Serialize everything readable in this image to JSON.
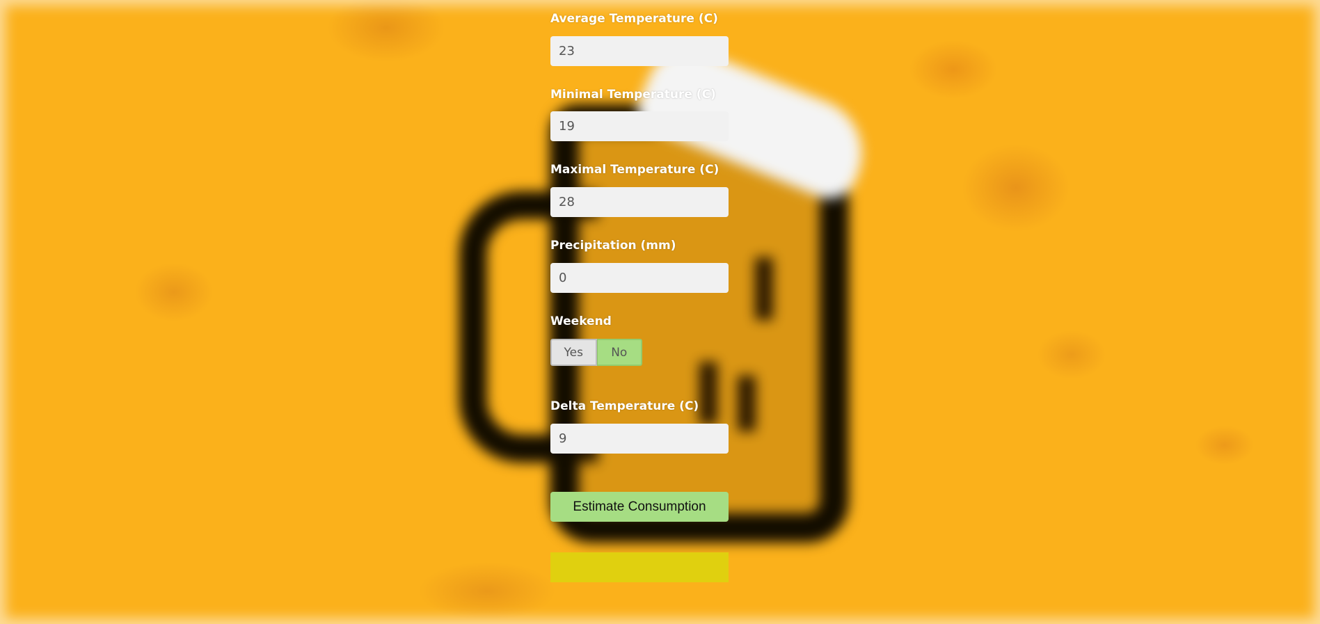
{
  "form": {
    "fields": [
      {
        "label": "Average Temperature (C)",
        "value": "23"
      },
      {
        "label": "Minimal Temperature (C)",
        "value": "19"
      },
      {
        "label": "Maximal Temperature (C)",
        "value": "28"
      },
      {
        "label": "Precipitation (mm)",
        "value": "0"
      }
    ],
    "weekend": {
      "label": "Weekend",
      "yes_label": "Yes",
      "no_label": "No",
      "selected": "No"
    },
    "delta": {
      "label": "Delta Temperature (C)",
      "value": "9"
    },
    "estimate_button": "Estimate Consumption",
    "result": ""
  },
  "colors": {
    "background": "#fbb11b",
    "button_green": "#a6dd83",
    "input_bg": "#f1f1f1",
    "result_yellow": "#e0d00f"
  }
}
